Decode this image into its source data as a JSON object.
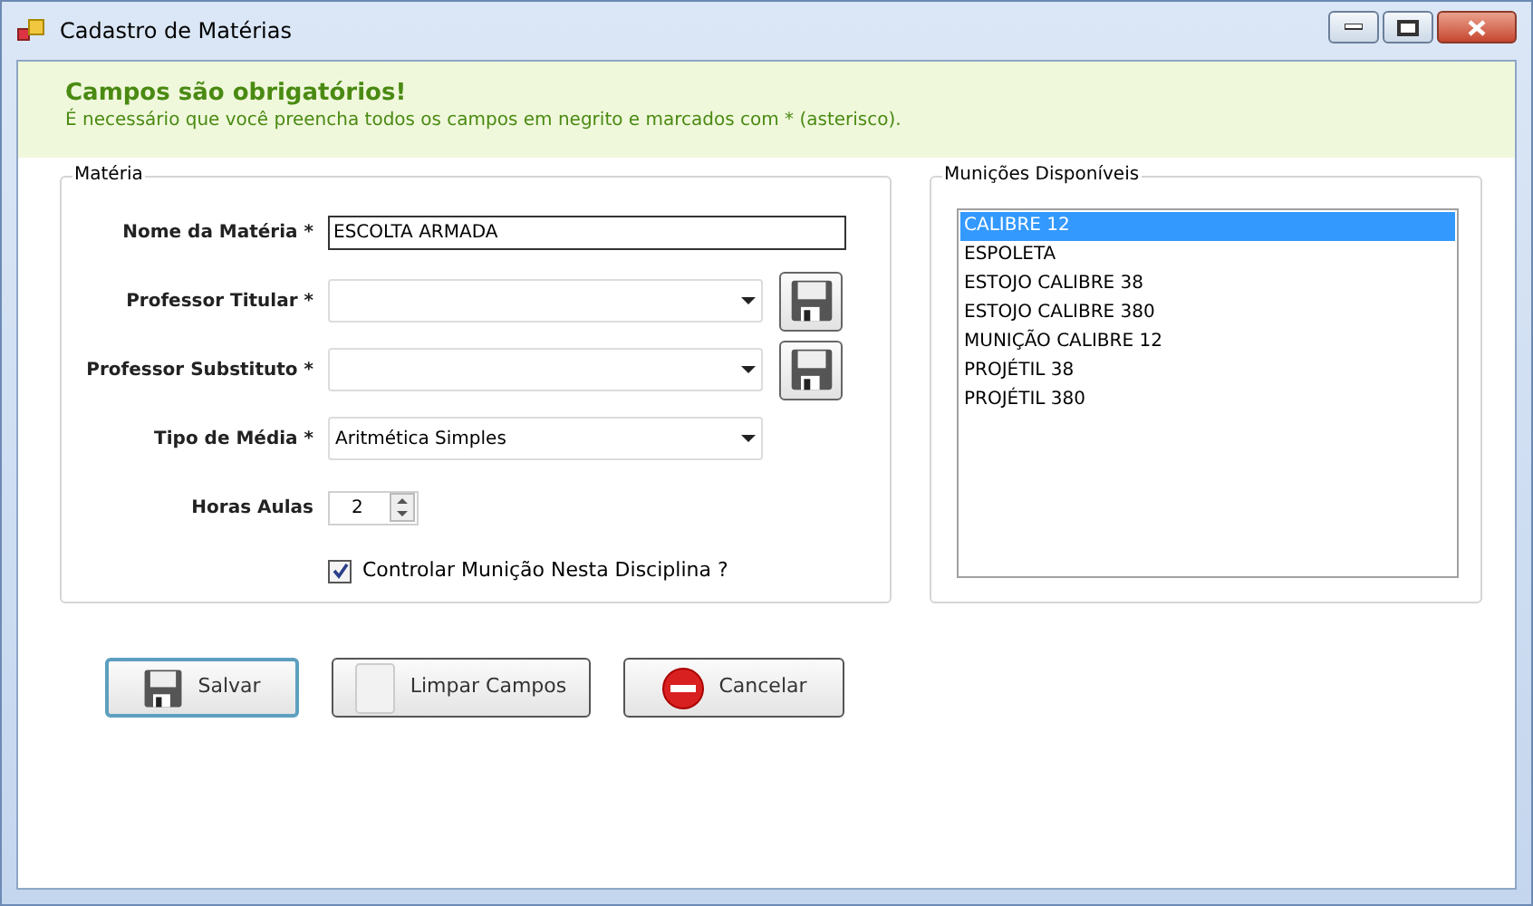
{
  "window": {
    "title": "Cadastro de Matérias"
  },
  "notice": {
    "title": "Campos são obrigatórios!",
    "text": "É necessário que você preencha todos os campos em negrito e marcados com * (asterisco)."
  },
  "materia": {
    "legend": "Matéria",
    "fields": [
      {
        "kind": "text",
        "label": "Nome da Matéria *",
        "value": "ESCOLTA ARMADA"
      },
      {
        "kind": "combo",
        "label": "Professor Titular *",
        "save_button": true
      },
      {
        "kind": "combo",
        "label": "Professor Substituto *",
        "save_button": true
      },
      {
        "kind": "combo",
        "label": "Tipo de Média *",
        "value": "Aritmética Simples"
      },
      {
        "kind": "spin",
        "label": "Horas Aulas",
        "value": "2"
      },
      {
        "kind": "check",
        "label": "Controlar Munição Nesta Disciplina ?",
        "checked": true
      }
    ]
  },
  "municoes": {
    "legend": "Munições Disponíveis",
    "items": [
      {
        "label": "CALIBRE 12",
        "selected": true
      },
      {
        "label": "ESPOLETA",
        "selected": false
      },
      {
        "label": "ESTOJO CALIBRE 38",
        "selected": false
      },
      {
        "label": "ESTOJO CALIBRE 380",
        "selected": false
      },
      {
        "label": "MUNIÇÃO CALIBRE 12",
        "selected": false
      },
      {
        "label": "PROJÉTIL 38",
        "selected": false
      },
      {
        "label": "PROJÉTIL 380",
        "selected": false
      }
    ]
  },
  "buttons": [
    {
      "kind": "save",
      "label": "Salvar",
      "focused": true
    },
    {
      "kind": "clear",
      "label": "Limpar Campos",
      "focused": false
    },
    {
      "kind": "cancel",
      "label": "Cancelar",
      "focused": false
    }
  ]
}
